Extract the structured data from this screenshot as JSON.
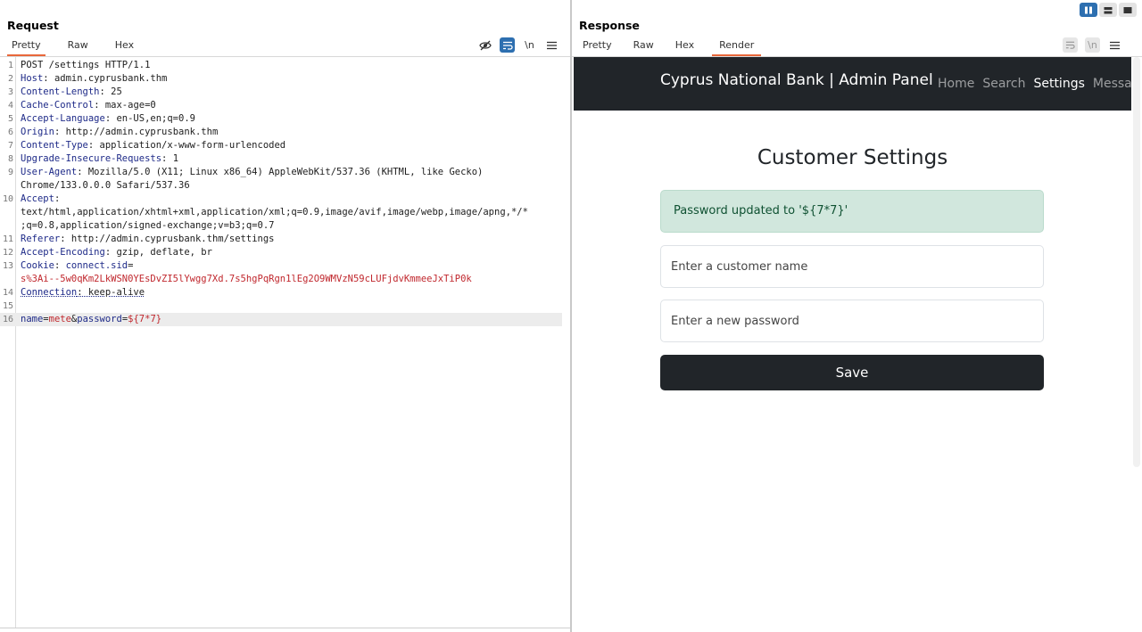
{
  "request": {
    "title": "Request",
    "tabs": [
      "Pretty",
      "Raw",
      "Hex"
    ],
    "active_tab": "Pretty",
    "lines": [
      {
        "n": "1",
        "parts": [
          {
            "t": "POST /settings HTTP/1.1",
            "c": ""
          }
        ]
      },
      {
        "n": "2",
        "parts": [
          {
            "t": "Host",
            "c": "hk"
          },
          {
            "t": ": admin.cyprusbank.thm",
            "c": ""
          }
        ]
      },
      {
        "n": "3",
        "parts": [
          {
            "t": "Content-Length",
            "c": "hk"
          },
          {
            "t": ": 25",
            "c": ""
          }
        ]
      },
      {
        "n": "4",
        "parts": [
          {
            "t": "Cache-Control",
            "c": "hk"
          },
          {
            "t": ": max-age=0",
            "c": ""
          }
        ]
      },
      {
        "n": "5",
        "parts": [
          {
            "t": "Accept-Language",
            "c": "hk"
          },
          {
            "t": ": en-US,en;q=0.9",
            "c": ""
          }
        ]
      },
      {
        "n": "6",
        "parts": [
          {
            "t": "Origin",
            "c": "hk"
          },
          {
            "t": ": http://admin.cyprusbank.thm",
            "c": ""
          }
        ]
      },
      {
        "n": "7",
        "parts": [
          {
            "t": "Content-Type",
            "c": "hk"
          },
          {
            "t": ": application/x-www-form-urlencoded",
            "c": ""
          }
        ]
      },
      {
        "n": "8",
        "parts": [
          {
            "t": "Upgrade-Insecure-Requests",
            "c": "hk"
          },
          {
            "t": ": 1",
            "c": ""
          }
        ]
      },
      {
        "n": "9",
        "parts": [
          {
            "t": "User-Agent",
            "c": "hk"
          },
          {
            "t": ": Mozilla/5.0 (X11; Linux x86_64) AppleWebKit/537.36 (KHTML, like Gecko)",
            "c": ""
          }
        ]
      },
      {
        "n": "",
        "parts": [
          {
            "t": "Chrome/133.0.0.0 Safari/537.36",
            "c": ""
          }
        ]
      },
      {
        "n": "10",
        "parts": [
          {
            "t": "Accept",
            "c": "hk"
          },
          {
            "t": ":",
            "c": ""
          }
        ]
      },
      {
        "n": "",
        "parts": [
          {
            "t": "text/html,application/xhtml+xml,application/xml;q=0.9,image/avif,image/webp,image/apng,*/*",
            "c": ""
          }
        ]
      },
      {
        "n": "",
        "parts": [
          {
            "t": ";q=0.8,application/signed-exchange;v=b3;q=0.7",
            "c": ""
          }
        ]
      },
      {
        "n": "11",
        "parts": [
          {
            "t": "Referer",
            "c": "hk"
          },
          {
            "t": ": http://admin.cyprusbank.thm/settings",
            "c": ""
          }
        ]
      },
      {
        "n": "12",
        "parts": [
          {
            "t": "Accept-Encoding",
            "c": "hk"
          },
          {
            "t": ": gzip, deflate, br",
            "c": ""
          }
        ]
      },
      {
        "n": "13",
        "parts": [
          {
            "t": "Cookie",
            "c": "hk"
          },
          {
            "t": ": ",
            "c": ""
          },
          {
            "t": "connect.sid",
            "c": "hk"
          },
          {
            "t": "=",
            "c": ""
          }
        ]
      },
      {
        "n": "",
        "parts": [
          {
            "t": "s%3Ai--5w0qKm2LkWSN0YEsDvZI5lYwgg7Xd.7s5hgPqRgn1lEg2O9WMVzN59cLUFjdvKmmeeJxTiP0k",
            "c": "red"
          }
        ]
      },
      {
        "n": "14",
        "parts": [
          {
            "t": "Connection",
            "c": "hk dots"
          },
          {
            "t": ": keep-alive",
            "c": "dots"
          }
        ]
      },
      {
        "n": "15",
        "parts": []
      },
      {
        "n": "16",
        "highlight": true,
        "parts": [
          {
            "t": "name",
            "c": "hk"
          },
          {
            "t": "=",
            "c": ""
          },
          {
            "t": "mete",
            "c": "red"
          },
          {
            "t": "&",
            "c": ""
          },
          {
            "t": "password",
            "c": "hk"
          },
          {
            "t": "=",
            "c": ""
          },
          {
            "t": "${7*7}",
            "c": "red"
          }
        ]
      }
    ],
    "tool_icons": [
      "eye-off-icon",
      "wrap-icon",
      "newline-icon",
      "menu-icon"
    ],
    "newline_label": "\\n"
  },
  "response": {
    "title": "Response",
    "tabs": [
      "Pretty",
      "Raw",
      "Hex",
      "Render"
    ],
    "active_tab": "Render",
    "newline_label": "\\n",
    "rendered": {
      "brand": "Cyprus National Bank | Admin Panel",
      "nav": [
        "Home",
        "Search",
        "Settings",
        "Messag"
      ],
      "nav_active": "Settings",
      "heading": "Customer Settings",
      "alert": "Password updated to '${7*7}'",
      "customer_placeholder": "Enter a customer name",
      "password_placeholder": "Enter a new password",
      "save_label": "Save"
    }
  },
  "colors": {
    "accent_tab": "#e8673a",
    "toggle_on": "#2d6fb0",
    "navbar_bg": "#212529",
    "alert_bg": "#d1e7dd",
    "alert_text": "#0f5132"
  }
}
